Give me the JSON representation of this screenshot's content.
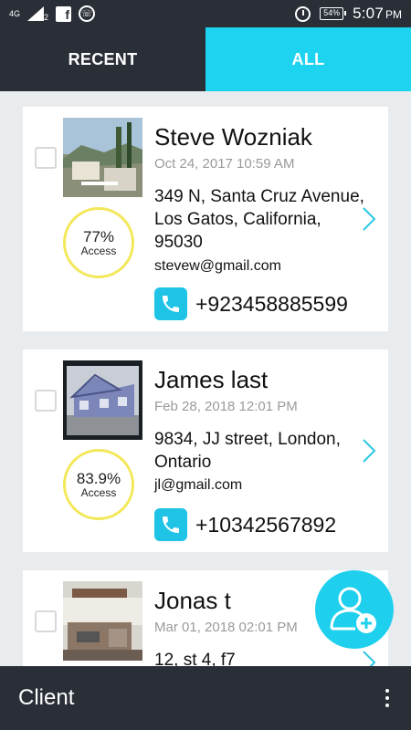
{
  "status_bar": {
    "network": "4G",
    "sim_slot": "2",
    "battery": "54%",
    "time": "5:07",
    "ampm": "PM",
    "icons": [
      "signal-icon",
      "facebook-icon",
      "whatsapp-icon",
      "alarm-icon",
      "battery-icon"
    ]
  },
  "tabs": [
    {
      "label": "RECENT",
      "active": false
    },
    {
      "label": "ALL",
      "active": true
    }
  ],
  "clients": [
    {
      "name": "Steve Wozniak",
      "date": "Oct 24, 2017 10:59 AM",
      "address": "349 N, Santa Cruz Avenue, Los Gatos, California, 95030",
      "email": "stevew@gmail.com",
      "phone": "+923458885599",
      "access_pct": "77%",
      "access_label": "Access"
    },
    {
      "name": "James last",
      "date": "Feb 28, 2018 12:01 PM",
      "address": "9834, JJ street, London, Ontario",
      "email": "jl@gmail.com",
      "phone": "+10342567892",
      "access_pct": "83.9%",
      "access_label": "Access"
    },
    {
      "name": "Jonas t",
      "date": "Mar 01, 2018 02:01 PM",
      "address": "12, st 4, f7"
    }
  ],
  "bottom_bar": {
    "title": "Client"
  },
  "colors": {
    "dark": "#2a2f37",
    "accent": "#1ed3ef",
    "ring": "#f3e75a"
  }
}
